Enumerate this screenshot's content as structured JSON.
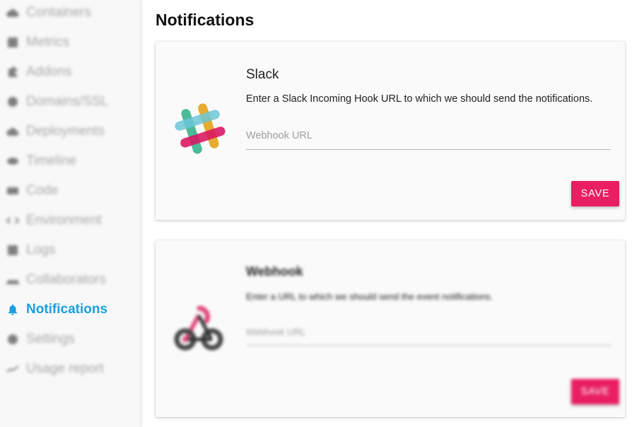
{
  "sidebar": {
    "items": [
      {
        "label": "Containers",
        "icon": "cloud-icon",
        "glyph": "☁",
        "active": false
      },
      {
        "label": "Metrics",
        "icon": "metrics-icon",
        "glyph": "▦",
        "active": false
      },
      {
        "label": "Addons",
        "icon": "puzzle-icon",
        "glyph": "✚",
        "active": false
      },
      {
        "label": "Domains/SSL",
        "icon": "globe-icon",
        "glyph": "●",
        "active": false
      },
      {
        "label": "Deployments",
        "icon": "cloud-upload-icon",
        "glyph": "☁",
        "active": false
      },
      {
        "label": "Timeline",
        "icon": "eye-icon",
        "glyph": "◉",
        "active": false
      },
      {
        "label": "Code",
        "icon": "code-icon",
        "glyph": "▬",
        "active": false
      },
      {
        "label": "Environment",
        "icon": "environment-icon",
        "glyph": "‹›",
        "active": false
      },
      {
        "label": "Logs",
        "icon": "logs-icon",
        "glyph": "☰",
        "active": false
      },
      {
        "label": "Collaborators",
        "icon": "people-icon",
        "glyph": "☗",
        "active": false
      },
      {
        "label": "Notifications",
        "icon": "bell-icon",
        "glyph": "🔔",
        "active": true
      },
      {
        "label": "Settings",
        "icon": "gear-icon",
        "glyph": "⚙",
        "active": false
      },
      {
        "label": "Usage report",
        "icon": "trending-icon",
        "glyph": "⟋",
        "active": false
      }
    ]
  },
  "page": {
    "title": "Notifications"
  },
  "slack": {
    "title": "Slack",
    "description": "Enter a Slack Incoming Hook URL to which we should send the notifications.",
    "url_placeholder": "Webhook URL",
    "url_value": "",
    "save_label": "SAVE"
  },
  "webhook": {
    "title": "Webhook",
    "description": "Enter a URL to which we should send the event notifications.",
    "url_placeholder": "Webhook URL",
    "url_value": "",
    "save_label": "SAVE"
  },
  "colors": {
    "accent": "#1a9fe0",
    "save_button": "#e91e63"
  }
}
